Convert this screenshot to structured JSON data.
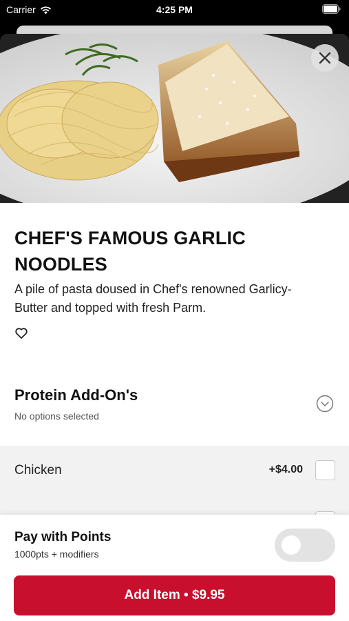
{
  "status_bar": {
    "carrier": "Carrier",
    "time": "4:25 PM"
  },
  "item": {
    "title": "CHEF'S FAMOUS GARLIC NOODLES",
    "description": "A pile of pasta doused in Chef's renowned Garlicy-Butter and topped with fresh Parm."
  },
  "modifier_group": {
    "title": "Protein Add-On's",
    "subtitle": "No options selected",
    "options": [
      {
        "name": "Chicken",
        "price": "+$4.00"
      }
    ]
  },
  "points": {
    "title": "Pay with Points",
    "subtitle": "1000pts + modifiers",
    "enabled": false
  },
  "cta": {
    "label": "Add Item • $9.95"
  },
  "colors": {
    "accent": "#c8102e"
  },
  "icons": [
    "wifi-icon",
    "battery-icon",
    "close-icon",
    "heart-icon",
    "chevron-down-icon"
  ]
}
